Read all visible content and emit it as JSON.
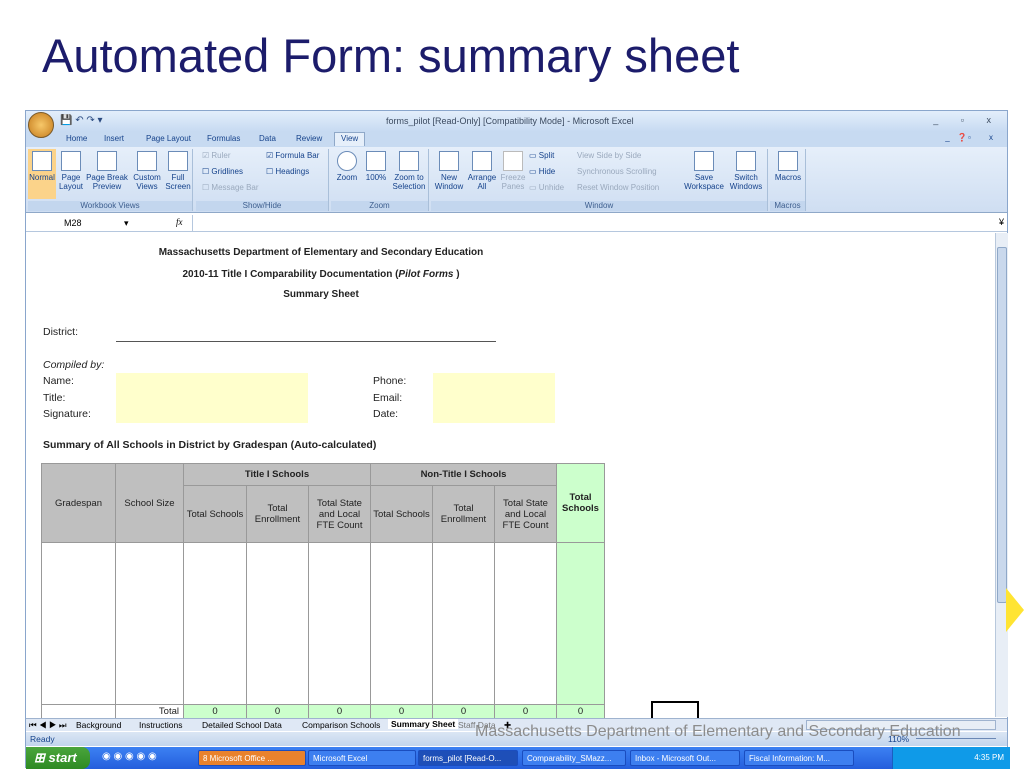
{
  "slide": {
    "title": "Automated Form: summary sheet",
    "footer": "Massachusetts Department of Elementary and Secondary Education"
  },
  "excel": {
    "window_title": "forms_pilot  [Read-Only]  [Compatibility Mode] - Microsoft Excel",
    "tabs": [
      "Home",
      "Insert",
      "Page Layout",
      "Formulas",
      "Data",
      "Review",
      "View"
    ],
    "active_tab": "View",
    "ribbon": {
      "workbook_views": {
        "label": "Workbook Views",
        "buttons": [
          "Normal",
          "Page Layout",
          "Page Break Preview",
          "Custom Views",
          "Full Screen"
        ]
      },
      "show_hide": {
        "label": "Show/Hide",
        "ruler": "Ruler",
        "gridlines": "Gridlines",
        "message_bar": "Message Bar",
        "formula_bar": "Formula Bar",
        "headings": "Headings"
      },
      "zoom": {
        "label": "Zoom",
        "buttons": [
          "Zoom",
          "100%",
          "Zoom to Selection"
        ]
      },
      "window": {
        "label": "Window",
        "buttons": [
          "New Window",
          "Arrange All",
          "Freeze Panes",
          "Save Workspace",
          "Switch Windows"
        ],
        "split": "Split",
        "hide": "Hide",
        "unhide": "Unhide",
        "side_by_side": "View Side by Side",
        "sync_scroll": "Synchronous Scrolling",
        "reset_pos": "Reset Window Position"
      },
      "macros": {
        "label": "Macros",
        "button": "Macros"
      }
    },
    "name_box": "M28",
    "fx": "fx",
    "sheet": {
      "heading1": "Massachusetts Department of Elementary and Secondary Education",
      "heading2": "2010-11 Title I Comparability Documentation (",
      "heading2_italic": "Pilot Forms",
      "heading2_end": " )",
      "heading3": "Summary Sheet",
      "district": "District:",
      "compiled_by": "Compiled by:",
      "name": "Name:",
      "title": "Title:",
      "signature": "Signature:",
      "phone": "Phone:",
      "email": "Email:",
      "date": "Date:",
      "summary_title": "Summary of All Schools in District by Gradespan (Auto-calculated)",
      "table": {
        "group_title1": "Title I Schools",
        "group_title2": "Non-Title I Schools",
        "headers": [
          "Gradespan",
          "School Size",
          "Total Schools",
          "Total Enrollment",
          "Total State and Local FTE Count",
          "Total Schools",
          "Total Enrollment",
          "Total State and Local FTE Count",
          "Total Schools"
        ],
        "total_label": "Total",
        "totals": [
          "0",
          "0",
          "0",
          "0",
          "0",
          "0",
          "0"
        ]
      }
    },
    "sheet_tabs": [
      "Background",
      "Instructions",
      "Detailed School Data",
      "Comparison Schools",
      "Summary Sheet",
      "Staff Data"
    ],
    "active_sheet": "Summary Sheet",
    "status": "Ready",
    "zoom_level": "110%"
  },
  "taskbar": {
    "start": "start",
    "items": [
      "8 Microsoft Office ...",
      "Microsoft Excel",
      "forms_pilot [Read-O...",
      "Comparability_SMazz...",
      "Inbox - Microsoft Out...",
      "Fiscal Information: M..."
    ],
    "clock": "4:35 PM"
  },
  "colors": {
    "title": "#1c1c6b",
    "header_gray": "#bfbfbf",
    "total_green": "#ccffcc",
    "input_yellow": "#ffffcc"
  }
}
